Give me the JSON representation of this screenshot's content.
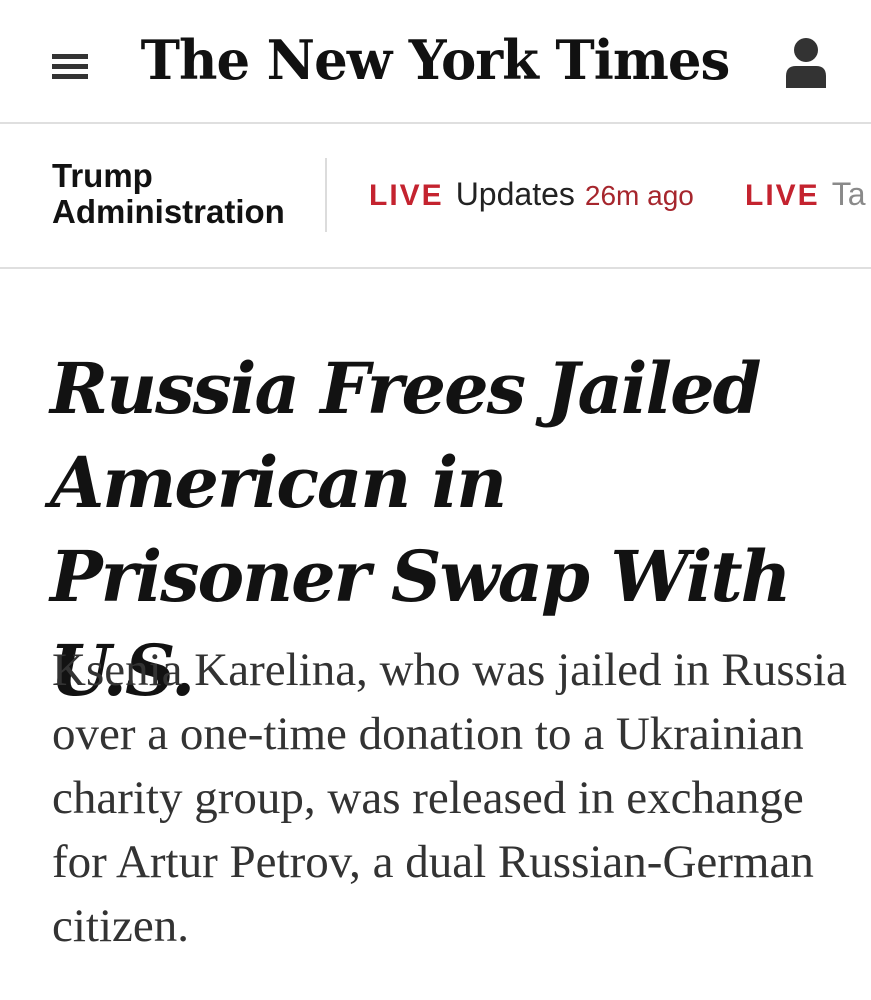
{
  "masthead": {
    "logo_text": "The New York Times",
    "menu_icon": "hamburger-menu-icon",
    "account_icon": "person-account-icon"
  },
  "subnav": {
    "section_label": "Trump Administration",
    "live_items": [
      {
        "tag": "LIVE",
        "text": "Updates",
        "time": "26m ago"
      },
      {
        "tag": "LIVE",
        "text": "Ta"
      }
    ],
    "colors": {
      "live_red": "#c4232f"
    }
  },
  "article": {
    "headline": "Russia Frees Jailed American in Prisoner Swap With U.S.",
    "summary": "Ksenia Karelina, who was jailed in Russia over a one-time donation to a Ukrainian charity group, was released in exchange for Artur Petrov, a dual Russian-German citizen."
  }
}
